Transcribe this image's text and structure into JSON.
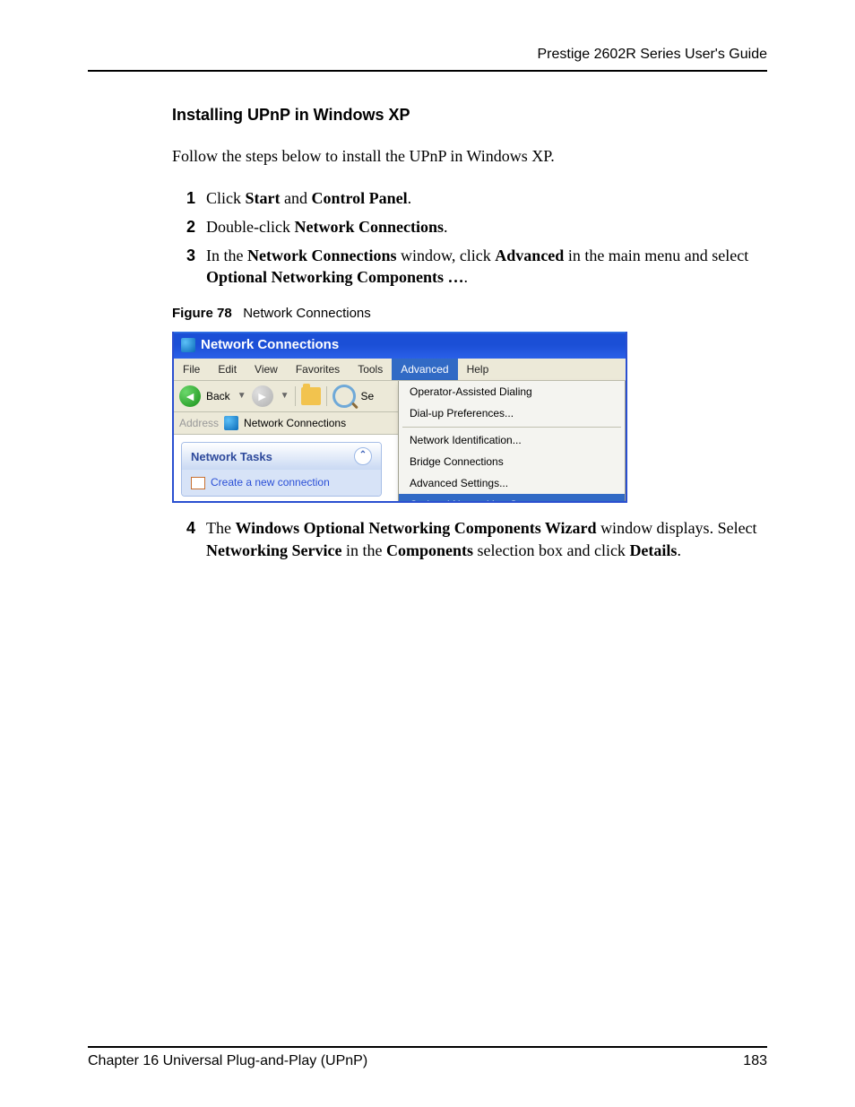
{
  "header": {
    "guide_title": "Prestige 2602R Series User's Guide"
  },
  "section": {
    "heading": "Installing UPnP in Windows XP",
    "intro": "Follow the steps below to install the UPnP in Windows XP."
  },
  "steps": {
    "s1_a": "Click ",
    "s1_b": "Start",
    "s1_c": " and ",
    "s1_d": "Control Panel",
    "s1_e": ".",
    "s2_a": "Double-click ",
    "s2_b": "Network Connections",
    "s2_c": ".",
    "s3_a": "In the ",
    "s3_b": "Network Connections",
    "s3_c": " window, click ",
    "s3_d": "Advanced",
    "s3_e": " in the main menu and select ",
    "s3_f": "Optional Networking Components …",
    "s3_g": ".",
    "s4_num": "4",
    "s4_a": "The ",
    "s4_b": "Windows Optional Networking Components Wizard",
    "s4_c": " window displays. Select ",
    "s4_d": "Networking Service",
    "s4_e": " in the ",
    "s4_f": "Components",
    "s4_g": " selection box and click ",
    "s4_h": "Details",
    "s4_i": "."
  },
  "figure": {
    "label": "Figure 78",
    "title": "Network Connections"
  },
  "xp": {
    "title": "Network Connections",
    "menu": {
      "file": "File",
      "edit": "Edit",
      "view": "View",
      "favorites": "Favorites",
      "tools": "Tools",
      "advanced": "Advanced",
      "help": "Help"
    },
    "toolbar": {
      "back": "Back",
      "search_hint": "Se"
    },
    "address": {
      "label": "Address",
      "value": "Network Connections"
    },
    "sidebar": {
      "header": "Network Tasks",
      "link1": "Create a new connection"
    },
    "dropdown": {
      "item1": "Operator-Assisted Dialing",
      "item2": "Dial-up Preferences...",
      "item3": "Network Identification...",
      "item4": "Bridge Connections",
      "item5": "Advanced Settings...",
      "item6": "Optional Networking Components..."
    }
  },
  "footer": {
    "chapter": "Chapter 16 Universal Plug-and-Play (UPnP)",
    "page": "183"
  }
}
